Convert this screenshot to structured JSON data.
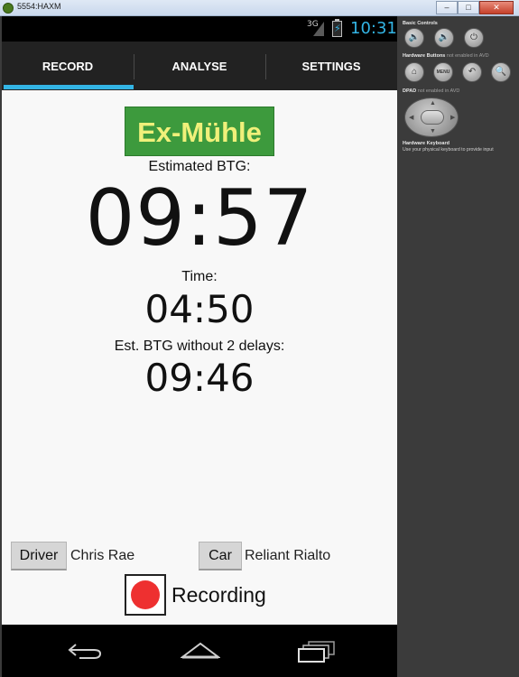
{
  "window": {
    "title": "5554:HAXM",
    "minimize": "–",
    "maximize": "□",
    "close": "✕"
  },
  "statusbar": {
    "network": "3G",
    "time": "10:31"
  },
  "tabs": [
    {
      "label": "RECORD",
      "selected": true
    },
    {
      "label": "ANALYSE",
      "selected": false
    },
    {
      "label": "SETTINGS",
      "selected": false
    }
  ],
  "main": {
    "station": "Ex-Mühle",
    "estimated_label": "Estimated BTG:",
    "estimated_value": "09:57",
    "time_label": "Time:",
    "time_value": "04:50",
    "without_delays_label": "Est. BTG without 2 delays:",
    "without_delays_value": "09:46"
  },
  "assignment": {
    "driver_button": "Driver",
    "driver_name": "Chris Rae",
    "car_button": "Car",
    "car_name": "Reliant Rialto"
  },
  "recording": {
    "label": "Recording"
  },
  "emulator_panel": {
    "basic_controls": "Basic Controls",
    "hardware_buttons": "Hardware Buttons",
    "hardware_buttons_note": "not enabled in AVD",
    "menu_label": "MENU",
    "dpad": "DPAD",
    "dpad_note": "not enabled in AVD",
    "keyboard": "Hardware Keyboard",
    "keyboard_hint": "Use your physical keyboard to provide input"
  },
  "colors": {
    "accent": "#33b5e5",
    "station_bg": "#3d9a3d",
    "station_text": "#f0f07a",
    "record_dot": "#ee3030"
  },
  "icons": [
    "back-icon",
    "home-icon",
    "recent-apps-icon",
    "battery-icon",
    "signal-icon",
    "volume-down-icon",
    "volume-up-icon",
    "power-icon",
    "search-icon"
  ]
}
